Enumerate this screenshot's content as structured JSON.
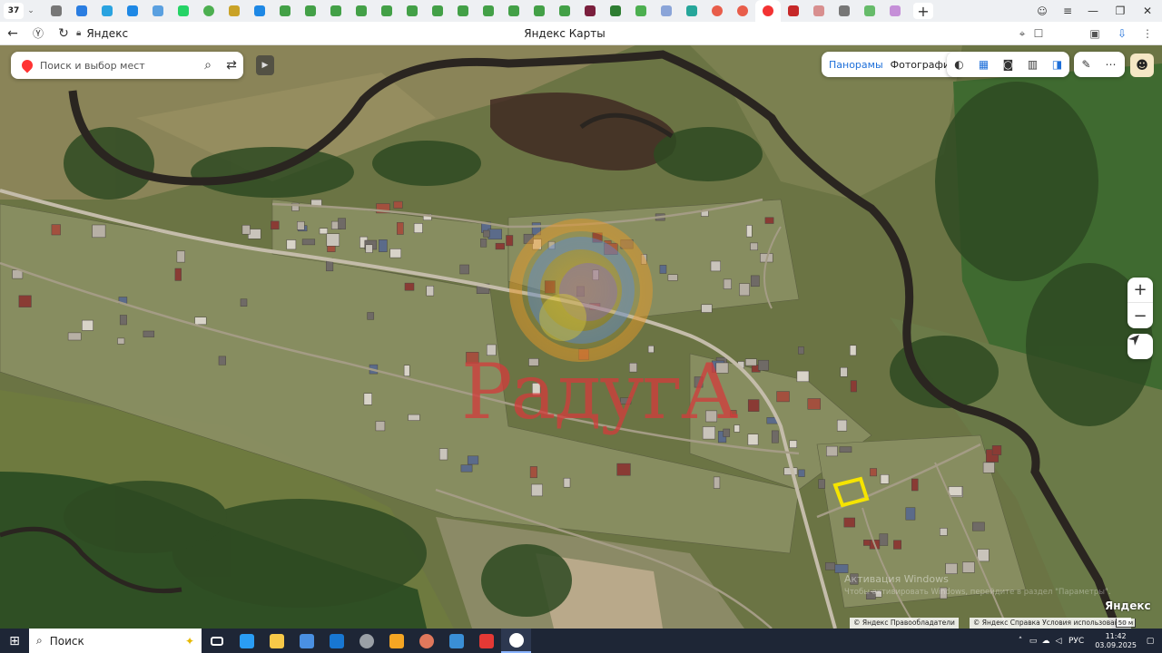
{
  "browser": {
    "tab_count": "37",
    "tabs": [
      {
        "icon": "doc-icon",
        "color": "#777777"
      },
      {
        "icon": "edge-icon",
        "color": "#2a7de1"
      },
      {
        "icon": "telegram-icon",
        "color": "#2aa3e0"
      },
      {
        "icon": "chat-icon",
        "color": "#1e88e5"
      },
      {
        "icon": "monitor-icon",
        "color": "#5aa0e0"
      },
      {
        "icon": "whatsapp-icon",
        "color": "#25d366"
      },
      {
        "icon": "green-circle-icon",
        "color": "#4caf50"
      },
      {
        "icon": "yellow-leaf-icon",
        "color": "#c9a227"
      },
      {
        "icon": "avito-icon",
        "color": "#1e88e5"
      },
      {
        "icon": "green-tab-icon",
        "color": "#43a047"
      },
      {
        "icon": "green-tab-icon",
        "color": "#43a047"
      },
      {
        "icon": "green-tab-icon",
        "color": "#43a047"
      },
      {
        "icon": "green-tab-icon",
        "color": "#43a047"
      },
      {
        "icon": "green-tab-icon",
        "color": "#43a047"
      },
      {
        "icon": "green-tab-icon",
        "color": "#43a047"
      },
      {
        "icon": "green-tab-icon",
        "color": "#43a047"
      },
      {
        "icon": "green-tab-icon",
        "color": "#43a047"
      },
      {
        "icon": "green-tab-icon",
        "color": "#43a047"
      },
      {
        "icon": "green-tab-icon",
        "color": "#43a047"
      },
      {
        "icon": "green-tab-icon",
        "color": "#43a047"
      },
      {
        "icon": "green-tab-icon",
        "color": "#43a047"
      },
      {
        "icon": "dark-p-icon",
        "color": "#7a1f3d"
      },
      {
        "icon": "green-table-icon",
        "color": "#2e7d32"
      },
      {
        "icon": "play-icon",
        "color": "#4caf50"
      },
      {
        "icon": "droplet-icon",
        "color": "#8aa4d8"
      },
      {
        "icon": "cross-icon",
        "color": "#26a69a"
      },
      {
        "icon": "red-circle-icon",
        "color": "#e85d4a"
      },
      {
        "icon": "red-circle-icon",
        "color": "#e85d4a"
      },
      {
        "icon": "yandex-maps-icon",
        "color": "#f33333",
        "active": true
      },
      {
        "icon": "red-square-icon",
        "color": "#c62828"
      },
      {
        "icon": "house-icon",
        "color": "#d88f8f"
      },
      {
        "icon": "doc-icon",
        "color": "#777777"
      },
      {
        "icon": "green-doc-icon",
        "color": "#66bb6a"
      },
      {
        "icon": "image-icon",
        "color": "#c58fd8"
      }
    ],
    "site_label": "Яндекс",
    "page_title": "Яндекс Карты"
  },
  "map_ui": {
    "search_placeholder": "Поиск и выбор мест",
    "layer_panoramas": "Панорамы",
    "layer_photos": "Фотографии",
    "zoom_in": "+",
    "zoom_out": "−",
    "watermark_text": "РадугА",
    "logo_text": "Яндекс",
    "copyright": [
      "© Яндекс",
      "Правообладатели",
      "© Яндекс",
      "Справка",
      "Условия использования"
    ],
    "scale_label": "50 м",
    "activation_title": "Активация Windows",
    "activation_text": "Чтобы активировать Windows, перейдите в раздел \"Параметры\"."
  },
  "taskbar": {
    "search_label": "Поиск",
    "language": "РУС",
    "time": "11:42",
    "date": "03.09.2025",
    "apps": [
      {
        "icon": "task-view-icon",
        "color": "#ffffff"
      },
      {
        "icon": "edge-icon",
        "color": "#2a9df4"
      },
      {
        "icon": "explorer-icon",
        "color": "#f7c948"
      },
      {
        "icon": "store-icon",
        "color": "#4a90e2"
      },
      {
        "icon": "outlook-icon",
        "color": "#1877d2"
      },
      {
        "icon": "vpn-icon",
        "color": "#9aa0a6"
      },
      {
        "icon": "yandex-music-icon",
        "color": "#f5a623"
      },
      {
        "icon": "chrome-like-icon",
        "color": "#e0785c"
      },
      {
        "icon": "monitor-icon",
        "color": "#3a8fd6"
      },
      {
        "icon": "yandex-icon",
        "color": "#e53935"
      },
      {
        "icon": "yandex-browser-icon",
        "color": "#ffffff",
        "active": true
      }
    ]
  }
}
